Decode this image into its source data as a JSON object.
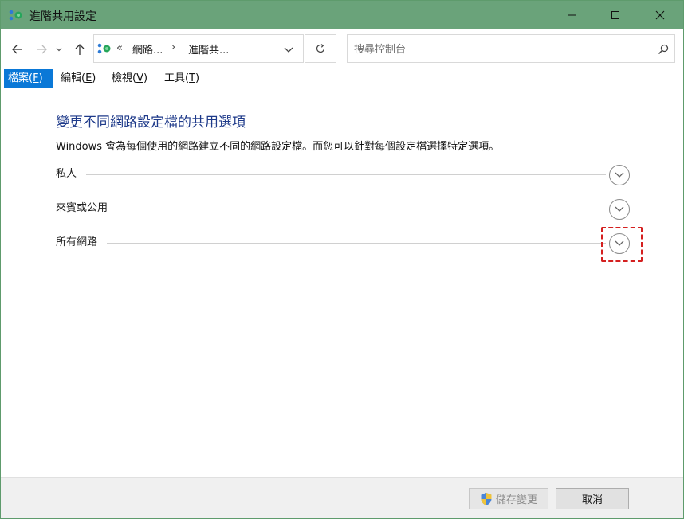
{
  "window": {
    "title": "進階共用設定"
  },
  "address": {
    "chevrons": "«",
    "crumbs": [
      "網路...",
      "進階共..."
    ],
    "separator": "›"
  },
  "search": {
    "placeholder": "搜尋控制台",
    "value": ""
  },
  "menu": {
    "file": {
      "label": "檔案(",
      "key": "F",
      "close": ")"
    },
    "edit": {
      "label": "編輯(",
      "key": "E",
      "close": ")"
    },
    "view": {
      "label": "檢視(",
      "key": "V",
      "close": ")"
    },
    "tools": {
      "label": "工具(",
      "key": "T",
      "close": ")"
    }
  },
  "content": {
    "heading": "變更不同網路設定檔的共用選項",
    "description": "Windows 會為每個使用的網路建立不同的網路設定檔。而您可以針對每個設定檔選擇特定選項。",
    "sections": [
      {
        "label": "私人"
      },
      {
        "label": "來賓或公用"
      },
      {
        "label": "所有網路"
      }
    ]
  },
  "footer": {
    "save_label": "儲存變更",
    "cancel_label": "取消"
  },
  "colors": {
    "titlebar": "#6aa37a",
    "accent": "#0a78d7",
    "heading": "#1e3a8a",
    "highlight": "#d42020"
  }
}
